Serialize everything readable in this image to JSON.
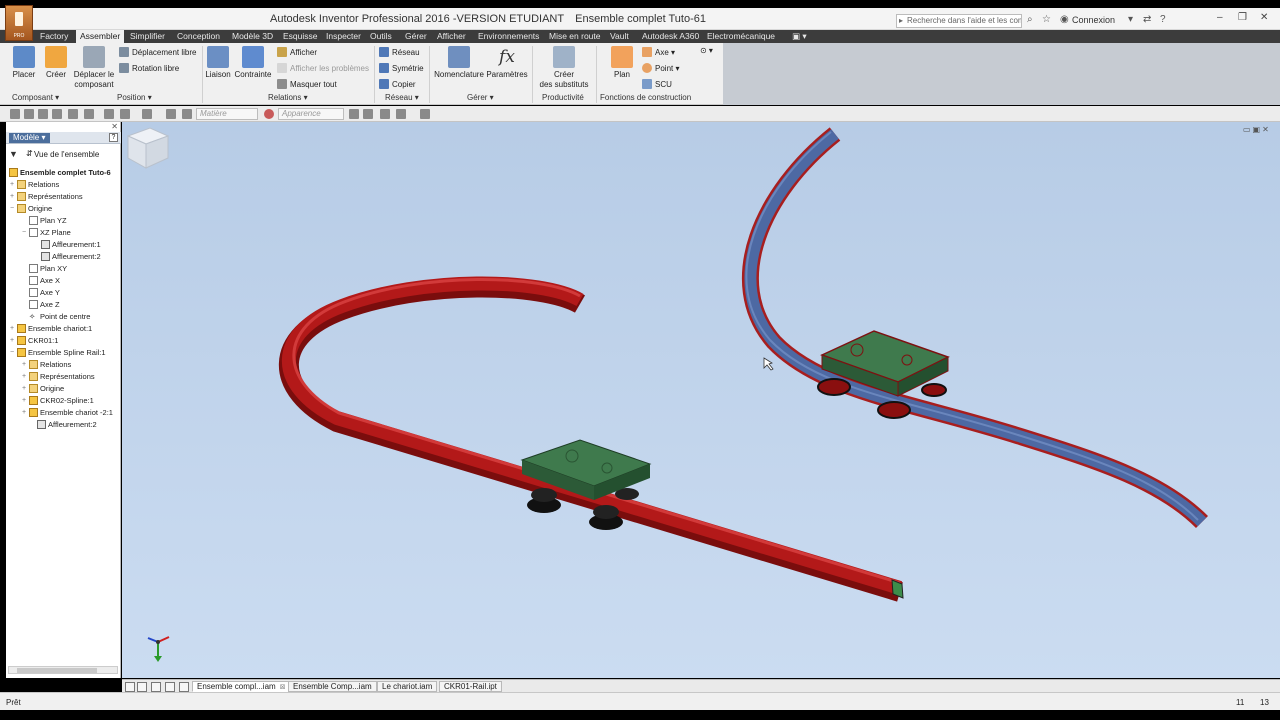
{
  "window": {
    "title": "Autodesk Inventor Professional 2016 -VERSION ETUDIANT",
    "document": "Ensemble complet Tuto-61",
    "search_placeholder": "Recherche dans l'aide et les com",
    "login": "Connexion",
    "logo_text": "PRO"
  },
  "menu": [
    "Factory",
    "Assembler",
    "Simplifier",
    "Conception",
    "Modèle 3D",
    "Esquisse",
    "Inspecter",
    "Outils",
    "Gérer",
    "Afficher",
    "Environnements",
    "Mise en route",
    "Vault",
    "Autodesk A360",
    "Electromécanique"
  ],
  "ribbon": {
    "placer": "Placer",
    "creer": "Créer",
    "deplacer_1": "Déplacer le",
    "deplacer_2": "composant",
    "deplacement_libre": "Déplacement libre",
    "rotation_libre": "Rotation libre",
    "liaison": "Liaison",
    "contrainte": "Contrainte",
    "afficher": "Afficher",
    "afficher_problemes": "Afficher les problèmes",
    "masquer_tout": "Masquer tout",
    "reseau": "Réseau",
    "symetrie": "Symétrie",
    "copier": "Copier",
    "nomenclature": "Nomenclature",
    "parametres": "Paramètres",
    "creer_substituts_1": "Créer",
    "creer_substituts_2": "des substituts",
    "plan": "Plan",
    "axe": "Axe",
    "point": "Point",
    "scu": "SCU",
    "panels": [
      "Composant",
      "Position",
      "Relations",
      "Réseau",
      "Gérer",
      "Productivité",
      "Fonctions de construction"
    ]
  },
  "qat": {
    "material": "Matière",
    "appearance": "Apparence"
  },
  "browser": {
    "tab": "Modèle",
    "view": "Vue de l'ensemble",
    "tree": [
      {
        "label": "Ensemble complet Tuto-6",
        "bold": true
      },
      {
        "label": "Relations"
      },
      {
        "label": "Représentations"
      },
      {
        "label": "Origine"
      },
      {
        "label": "Plan YZ"
      },
      {
        "label": "XZ Plane"
      },
      {
        "label": "Affleurement:1"
      },
      {
        "label": "Affleurement:2"
      },
      {
        "label": "Plan XY"
      },
      {
        "label": "Axe X"
      },
      {
        "label": "Axe Y"
      },
      {
        "label": "Axe Z"
      },
      {
        "label": "Point de centre"
      },
      {
        "label": "Ensemble chariot:1"
      },
      {
        "label": "CKR01:1"
      },
      {
        "label": "Ensemble Spline Rail:1"
      },
      {
        "label": "Relations"
      },
      {
        "label": "Représentations"
      },
      {
        "label": "Origine"
      },
      {
        "label": "CKR02-Spline:1"
      },
      {
        "label": "Ensemble chariot -2:1"
      },
      {
        "label": "Affleurement:2"
      }
    ]
  },
  "documents": [
    "Ensemble compl...iam",
    "Ensemble Comp...iam",
    "Le chariot.iam",
    "CKR01-Rail.ipt"
  ],
  "status": {
    "text": "Prêt",
    "n1": "11",
    "n2": "13"
  },
  "colors": {
    "rail_red": "#b01818",
    "rail_blue": "#4a6aa6",
    "carriage_green": "#3f7a4d",
    "viewport_bg": "#c3d6ee"
  }
}
